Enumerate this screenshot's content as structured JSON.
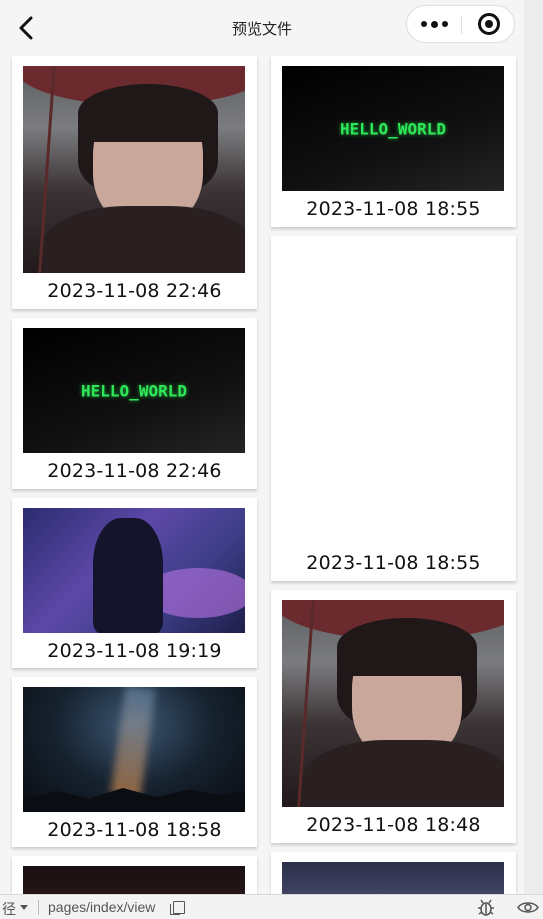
{
  "navbar": {
    "title": "预览文件"
  },
  "cards": {
    "left": [
      {
        "date": "2023-11-08 22:46",
        "image": "girl-umbrella"
      },
      {
        "date": "2023-11-08 22:46",
        "image": "hello-world",
        "caption": "HELLO_WORLD"
      },
      {
        "date": "2023-11-08 19:19",
        "image": "purple-warrior"
      },
      {
        "date": "2023-11-08 18:58",
        "image": "galaxy-night"
      },
      {
        "image": "dark-dragon"
      }
    ],
    "right": [
      {
        "date": "2023-11-08 18:55",
        "image": "hello-world",
        "caption": "HELLO_WORLD"
      },
      {
        "date": "2023-11-08 18:55",
        "image": "blank"
      },
      {
        "date": "2023-11-08 18:48",
        "image": "girl-umbrella"
      },
      {
        "image": "cyber-girl"
      }
    ]
  },
  "bottombar": {
    "path_label": "径",
    "path": "pages/index/view"
  },
  "icons": {
    "back": "chevron-left-icon",
    "more": "more-dots-icon",
    "close": "target-icon",
    "copy": "copy-icon",
    "debug": "bug-icon",
    "preview": "eye-icon"
  },
  "colors": {
    "hello_text": "#2fe85a",
    "background": "#f5f5f5"
  }
}
